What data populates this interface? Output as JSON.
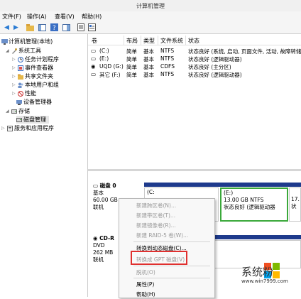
{
  "window": {
    "title": "计算机管理"
  },
  "menubar": [
    "文件(F)",
    "操作(A)",
    "查看(V)",
    "帮助(H)"
  ],
  "tree": {
    "root": "计算机管理(本地)",
    "items": [
      {
        "label": "系统工具",
        "level": 1
      },
      {
        "label": "任务计划程序",
        "level": 2
      },
      {
        "label": "事件查看器",
        "level": 2
      },
      {
        "label": "共享文件夹",
        "level": 2
      },
      {
        "label": "本地用户和组",
        "level": 2
      },
      {
        "label": "性能",
        "level": 2
      },
      {
        "label": "设备管理器",
        "level": 2
      },
      {
        "label": "存储",
        "level": 1
      },
      {
        "label": "磁盘管理",
        "level": 2
      },
      {
        "label": "服务和应用程序",
        "level": 1
      }
    ]
  },
  "volumes": {
    "headers": [
      "卷",
      "布局",
      "类型",
      "文件系统",
      "状态"
    ],
    "rows": [
      {
        "vol": "(C:)",
        "layout": "简单",
        "type": "基本",
        "fs": "NTFS",
        "status": "状态良好 (系统, 启动, 页面文件, 活动, 故障转储"
      },
      {
        "vol": "(E:)",
        "layout": "简单",
        "type": "基本",
        "fs": "NTFS",
        "status": "状态良好 (逻辑驱动器)"
      },
      {
        "vol": "UQD (G:)",
        "layout": "简单",
        "type": "基本",
        "fs": "CDFS",
        "status": "状态良好 (主分区)"
      },
      {
        "vol": "其它 (F:)",
        "layout": "简单",
        "type": "基本",
        "fs": "NTFS",
        "status": "状态良好 (逻辑驱动器)"
      }
    ]
  },
  "disk0": {
    "name": "磁盘 0",
    "type": "基本",
    "size": "60.00 GB",
    "state": "联机",
    "part_c": "(C:",
    "part_e_name": "(E:)",
    "part_e_size": "13.00 GB NTFS",
    "part_e_status": "状态良好 (逻辑驱动器",
    "part_f_size": "17.",
    "part_f_status": "状"
  },
  "cdrom": {
    "name": "CD-R",
    "type": "DVD",
    "size": "262 MB",
    "state": "联机"
  },
  "context_menu": {
    "items": [
      {
        "label": "新建跨区卷(N)...",
        "enabled": false
      },
      {
        "label": "新建带区卷(T)...",
        "enabled": false
      },
      {
        "label": "新建镜像卷(R)...",
        "enabled": false
      },
      {
        "label": "新建 RAID-5 卷(W)...",
        "enabled": false
      },
      {
        "label": "转换到动态磁盘(C)...",
        "enabled": true
      },
      {
        "label": "转换成 GPT 磁盘(V)",
        "enabled": false
      },
      {
        "label": "脱机(O)",
        "enabled": false
      },
      {
        "label": "属性(P)",
        "enabled": true
      },
      {
        "label": "帮助(H)",
        "enabled": true
      }
    ]
  },
  "watermark": {
    "brand": "系统粉",
    "url": "www.win7999.com"
  },
  "colors": {
    "partition_bar": "#1e3a8c",
    "highlight": "#e0302f"
  }
}
